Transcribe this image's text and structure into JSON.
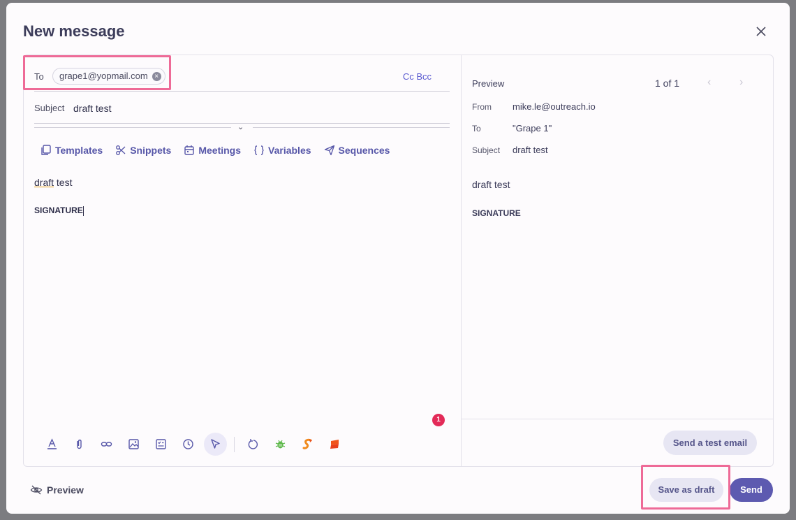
{
  "modal": {
    "title": "New message"
  },
  "compose": {
    "to_label": "To",
    "recipient": "grape1@yopmail.com",
    "cc_bcc": "Cc Bcc",
    "subject_label": "Subject",
    "subject_value": "draft test",
    "toolbar": [
      "Templates",
      "Snippets",
      "Meetings",
      "Variables",
      "Sequences"
    ],
    "body_word1": "draft",
    "body_word2": " test",
    "signature": "SIGNATURE",
    "notification_count": "1",
    "format_icons": [
      "text-color-icon",
      "attachment-icon",
      "link-icon",
      "image-icon",
      "checklist-icon",
      "clock-icon",
      "cursor-icon",
      "undo-icon",
      "bug-icon",
      "sequence-s-icon",
      "flag-icon"
    ]
  },
  "preview": {
    "title": "Preview",
    "count": "1 of 1",
    "from_label": "From",
    "from_value": "mike.le@outreach.io",
    "to_label": "To",
    "to_value": "\"Grape 1\"",
    "subject_label": "Subject",
    "subject_value": "draft test",
    "body": "draft test",
    "signature": "SIGNATURE",
    "test_button": "Send a test email"
  },
  "footer": {
    "preview_toggle": "Preview",
    "save_draft": "Save as draft",
    "send": "Send"
  },
  "colors": {
    "accent": "#5d5ab0",
    "highlight": "#ee6a97",
    "badge": "#e32a58"
  }
}
